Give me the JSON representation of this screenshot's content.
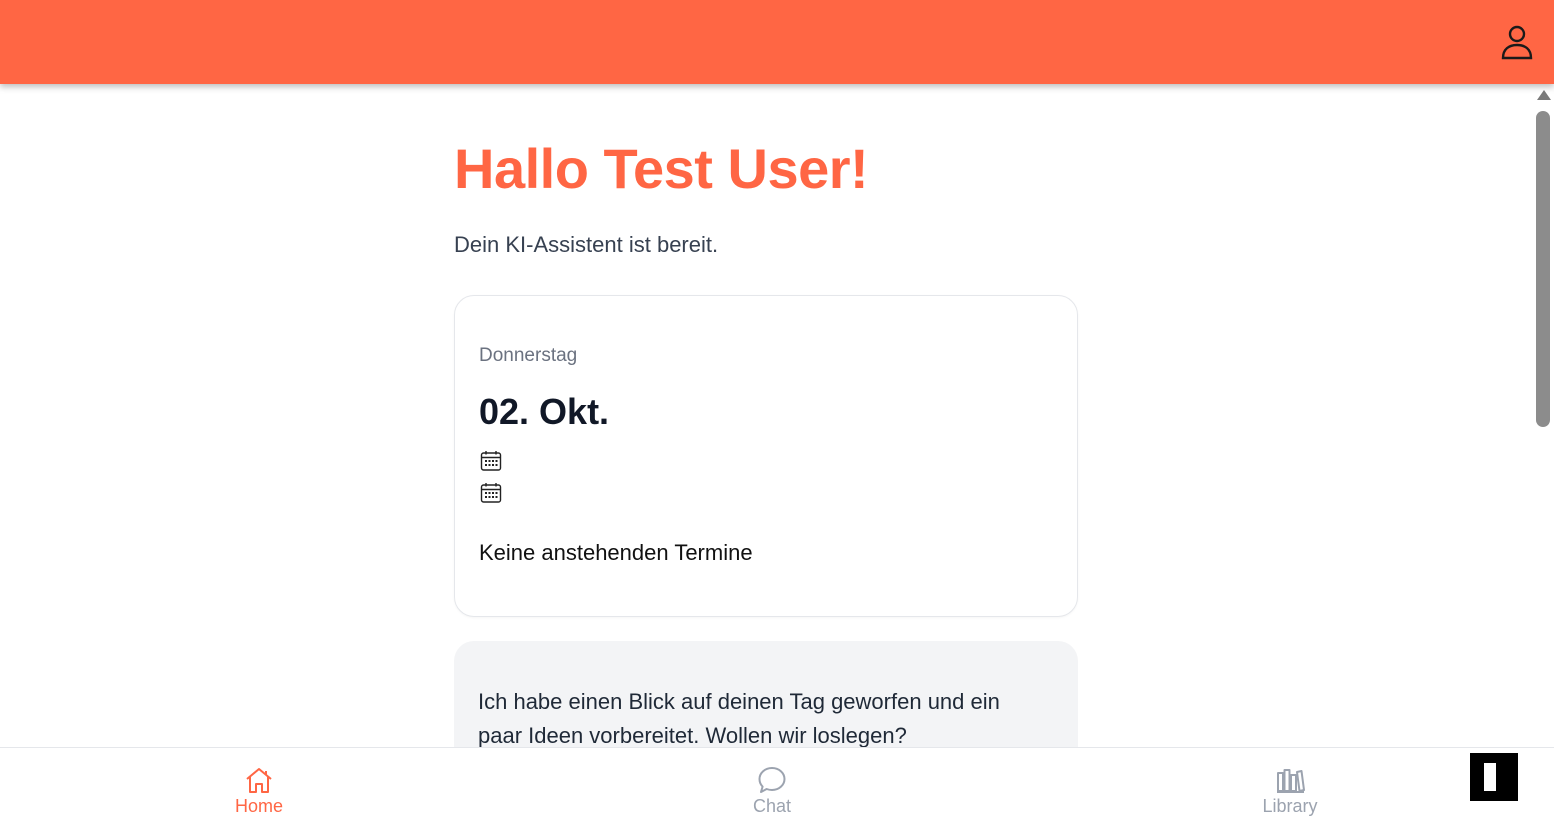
{
  "colors": {
    "accent": "#FF6644",
    "nav_inactive": "#9ca3af",
    "card_muted_bg": "#f3f4f6"
  },
  "header": {
    "profile_icon": "user-icon"
  },
  "main": {
    "greeting": "Hallo Test User!",
    "subtitle": "Dein KI-Assistent ist bereit.",
    "date_card": {
      "weekday": "Donnerstag",
      "date": "02. Okt.",
      "icons": [
        "calendar-icon",
        "calendar-icon"
      ],
      "empty_text": "Keine anstehenden Termine"
    },
    "assistant_card": {
      "text": "Ich habe einen Blick auf deinen Tag geworfen und ein paar Ideen vorbereitet. Wollen wir loslegen?"
    }
  },
  "bottom_nav": {
    "items": [
      {
        "label": "Home",
        "icon": "home-icon",
        "active": true
      },
      {
        "label": "Chat",
        "icon": "chat-bubble-icon",
        "active": false
      },
      {
        "label": "Library",
        "icon": "library-books-icon",
        "active": false
      }
    ]
  }
}
